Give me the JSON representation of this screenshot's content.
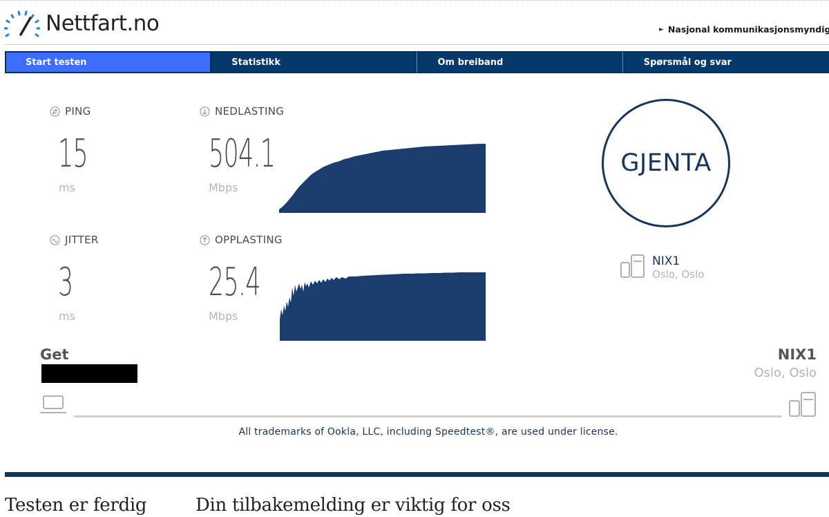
{
  "header": {
    "site_name": "Nettfart.no",
    "top_link": "Nasjonal kommunikasjonsmyndig"
  },
  "nav": {
    "tabs": [
      {
        "label": "Start testen",
        "active": true
      },
      {
        "label": "Statistikk",
        "active": false
      },
      {
        "label": "Om breiband",
        "active": false
      },
      {
        "label": "Spørsmål og svar",
        "active": false
      }
    ]
  },
  "results": {
    "ping": {
      "label": "PING",
      "value": "15",
      "unit": "ms",
      "icon": "ping-icon"
    },
    "jitter": {
      "label": "JITTER",
      "value": "3",
      "unit": "ms",
      "icon": "jitter-icon"
    },
    "download": {
      "label": "NEDLASTING",
      "value": "504.1",
      "unit": "Mbps",
      "icon": "download-arrow-icon"
    },
    "upload": {
      "label": "OPPLASTING",
      "value": "25.4",
      "unit": "Mbps",
      "icon": "upload-arrow-icon"
    }
  },
  "gjenta_button": "GJENTA",
  "server": {
    "name": "NIX1",
    "city": "Oslo, Oslo"
  },
  "connection": {
    "isp": "Get",
    "host_name": "NIX1",
    "host_city": "Oslo, Oslo"
  },
  "trademark": "All trademarks of Ookla, LLC, including Speedtest®, are used under license.",
  "sections": {
    "done_title": "Testen er ferdig",
    "feedback_title": "Din tilbakemelding er viktig for oss"
  },
  "colors": {
    "navy": "#17345f",
    "nav_bg": "#05386b",
    "nav_active": "#3d6dfc",
    "graph_fill": "#1a3d6e"
  }
}
